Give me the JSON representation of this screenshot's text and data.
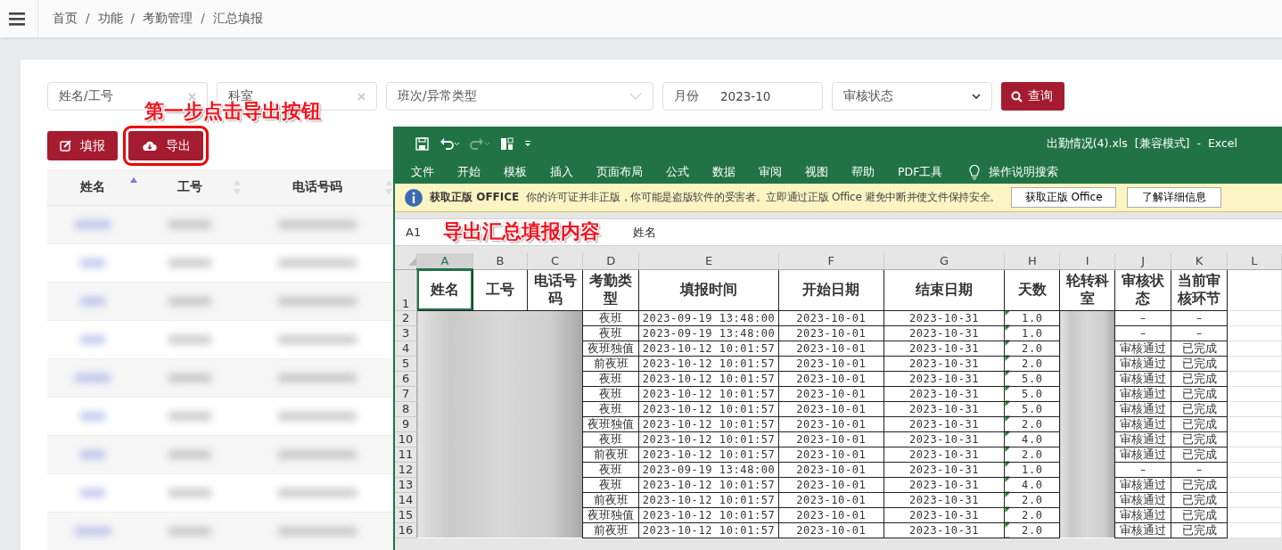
{
  "breadcrumb": [
    {
      "kind": "item",
      "text": "首页"
    },
    {
      "kind": "separator",
      "text": "/"
    },
    {
      "kind": "item",
      "text": "功能"
    },
    {
      "kind": "separator",
      "text": "/"
    },
    {
      "kind": "item",
      "text": "考勤管理"
    },
    {
      "kind": "separator",
      "text": "/"
    },
    {
      "kind": "item",
      "text": "汇总填报"
    }
  ],
  "filters": [
    {
      "kind": "text",
      "placeholder": "姓名/工号"
    },
    {
      "kind": "text",
      "placeholder": "科室"
    },
    {
      "kind": "select",
      "placeholder": "班次/异常类型"
    },
    {
      "kind": "month",
      "label": "月份",
      "value": "2023-10"
    },
    {
      "kind": "dropdown",
      "placeholder": "审核状态"
    }
  ],
  "search_button": "查询",
  "actions": [
    {
      "kind": "edit",
      "label": "填报"
    },
    {
      "kind": "export",
      "label": "导出"
    }
  ],
  "table": {
    "columns": [
      {
        "label": "姓名",
        "sorted_ascending": true
      },
      {
        "label": "工号",
        "sorted_ascending": false
      },
      {
        "label": "电话号码",
        "sorted_ascending": false
      }
    ],
    "rows": [
      {
        "kind": "redacted"
      },
      {
        "kind": "redacted"
      },
      {
        "kind": "redacted"
      },
      {
        "kind": "redacted"
      },
      {
        "kind": "redacted"
      },
      {
        "kind": "redacted"
      },
      {
        "kind": "redacted"
      },
      {
        "kind": "redacted"
      },
      {
        "kind": "redacted"
      }
    ]
  },
  "annotations": [
    {
      "text": "第一步点击导出按钮"
    },
    {
      "text": "导出汇总填报内容"
    }
  ],
  "excel": {
    "title": "出勤情况(4).xls  [兼容模式]  -  Excel",
    "ribbon_tabs": [
      "文件",
      "开始",
      "模板",
      "插入",
      "页面布局",
      "公式",
      "数据",
      "审阅",
      "视图",
      "帮助",
      "PDF工具"
    ],
    "tell_me": "操作说明搜索",
    "message_bar": {
      "title": "获取正版 OFFICE",
      "text": "你的许可证并非正版，你可能是盗版软件的受害者。立即通过正版 Office 避免中断并使文件保持安全。",
      "buttons": [
        "获取正版 Office",
        "了解详细信息"
      ]
    },
    "name_box": "A1",
    "formula": "姓名",
    "header_row": "1",
    "columns": [
      {
        "letter": "A",
        "header": "姓名",
        "redacted": true,
        "selected": true
      },
      {
        "letter": "B",
        "header": "工号",
        "redacted": true,
        "selected": false
      },
      {
        "letter": "C",
        "header": "电话号码",
        "redacted": true,
        "selected": false
      },
      {
        "letter": "D",
        "header": "考勤类型",
        "redacted": false,
        "selected": false
      },
      {
        "letter": "E",
        "header": "填报时间",
        "redacted": false,
        "selected": false
      },
      {
        "letter": "F",
        "header": "开始日期",
        "redacted": false,
        "selected": false
      },
      {
        "letter": "G",
        "header": "结束日期",
        "redacted": false,
        "selected": false
      },
      {
        "letter": "H",
        "header": "天数",
        "redacted": false,
        "selected": false,
        "error_indicator": true
      },
      {
        "letter": "I",
        "header": "轮转科室",
        "redacted": true,
        "selected": false
      },
      {
        "letter": "J",
        "header": "审核状态",
        "redacted": false,
        "selected": false
      },
      {
        "letter": "K",
        "header": "当前审核环节",
        "redacted": false,
        "selected": false
      },
      {
        "letter": "L",
        "redacted": false,
        "selected": false
      }
    ],
    "rows": [
      {
        "number": "2",
        "values": [
          "夜班",
          "2023-09-19 13:48:00",
          "2023-10-01",
          "2023-10-31",
          "1.0",
          "–",
          "–"
        ]
      },
      {
        "number": "3",
        "values": [
          "夜班",
          "2023-09-19 13:48:00",
          "2023-10-01",
          "2023-10-31",
          "1.0",
          "–",
          "–"
        ]
      },
      {
        "number": "4",
        "values": [
          "夜班独值",
          "2023-10-12 10:01:57",
          "2023-10-01",
          "2023-10-31",
          "2.0",
          "审核通过",
          "已完成"
        ]
      },
      {
        "number": "5",
        "values": [
          "前夜班",
          "2023-10-12 10:01:57",
          "2023-10-01",
          "2023-10-31",
          "2.0",
          "审核通过",
          "已完成"
        ]
      },
      {
        "number": "6",
        "values": [
          "夜班",
          "2023-10-12 10:01:57",
          "2023-10-01",
          "2023-10-31",
          "5.0",
          "审核通过",
          "已完成"
        ]
      },
      {
        "number": "7",
        "values": [
          "夜班",
          "2023-10-12 10:01:57",
          "2023-10-01",
          "2023-10-31",
          "5.0",
          "审核通过",
          "已完成"
        ]
      },
      {
        "number": "8",
        "values": [
          "夜班",
          "2023-10-12 10:01:57",
          "2023-10-01",
          "2023-10-31",
          "5.0",
          "审核通过",
          "已完成"
        ]
      },
      {
        "number": "9",
        "values": [
          "夜班独值",
          "2023-10-12 10:01:57",
          "2023-10-01",
          "2023-10-31",
          "2.0",
          "审核通过",
          "已完成"
        ]
      },
      {
        "number": "10",
        "values": [
          "夜班",
          "2023-10-12 10:01:57",
          "2023-10-01",
          "2023-10-31",
          "4.0",
          "审核通过",
          "已完成"
        ]
      },
      {
        "number": "11",
        "values": [
          "前夜班",
          "2023-10-12 10:01:57",
          "2023-10-01",
          "2023-10-31",
          "2.0",
          "审核通过",
          "已完成"
        ]
      },
      {
        "number": "12",
        "values": [
          "夜班",
          "2023-09-19 13:48:00",
          "2023-10-01",
          "2023-10-31",
          "1.0",
          "–",
          "–"
        ]
      },
      {
        "number": "13",
        "values": [
          "夜班",
          "2023-10-12 10:01:57",
          "2023-10-01",
          "2023-10-31",
          "4.0",
          "审核通过",
          "已完成"
        ]
      },
      {
        "number": "14",
        "values": [
          "前夜班",
          "2023-10-12 10:01:57",
          "2023-10-01",
          "2023-10-31",
          "2.0",
          "审核通过",
          "已完成"
        ]
      },
      {
        "number": "15",
        "values": [
          "夜班独值",
          "2023-10-12 10:01:57",
          "2023-10-01",
          "2023-10-31",
          "2.0",
          "审核通过",
          "已完成"
        ]
      },
      {
        "number": "16",
        "values": [
          "前夜班",
          "2023-10-12 10:01:57",
          "2023-10-01",
          "2023-10-31",
          "2.0",
          "审核通过",
          "已完成"
        ]
      }
    ]
  }
}
